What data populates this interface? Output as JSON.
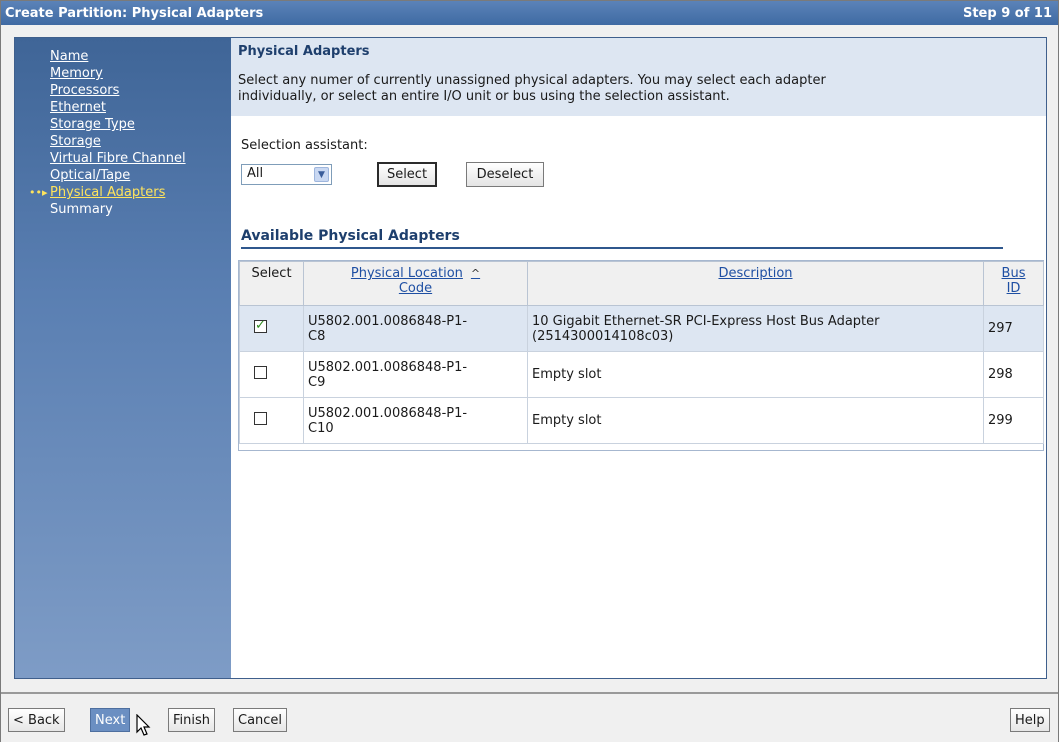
{
  "window": {
    "title": "Create Partition: Physical Adapters",
    "step": "Step 9 of 11"
  },
  "nav": {
    "items": [
      {
        "label": "Name",
        "current": false,
        "link": true
      },
      {
        "label": "Memory",
        "current": false,
        "link": true
      },
      {
        "label": "Processors",
        "current": false,
        "link": true
      },
      {
        "label": "Ethernet",
        "current": false,
        "link": true
      },
      {
        "label": "Storage Type",
        "current": false,
        "link": true
      },
      {
        "label": "Storage",
        "current": false,
        "link": true
      },
      {
        "label": "Virtual Fibre Channel",
        "current": false,
        "link": true
      },
      {
        "label": "Optical/Tape",
        "current": false,
        "link": true
      },
      {
        "label": "Physical Adapters",
        "current": true,
        "link": true
      },
      {
        "label": "Summary",
        "current": false,
        "link": false
      }
    ]
  },
  "section": {
    "title": "Physical Adapters",
    "description_line1": "Select any numer of currently unassigned physical adapters. You may select each adapter",
    "description_line2": "individually, or select an entire I/O unit or bus using the selection assistant."
  },
  "assistant": {
    "label": "Selection assistant:",
    "selected": "All",
    "select_label": "Select",
    "deselect_label": "Deselect"
  },
  "table": {
    "title": "Available Physical Adapters",
    "headers": {
      "select": "Select",
      "location_line1": "Physical Location",
      "location_line2": "Code",
      "description": "Description",
      "bus_line1": "Bus",
      "bus_line2": "ID"
    },
    "rows": [
      {
        "checked": true,
        "loc1": "U5802.001.0086848-P1-",
        "loc2": "C8",
        "desc1": "10 Gigabit Ethernet-SR PCI-Express Host Bus Adapter",
        "desc2": "(2514300014108c03)",
        "bus": "297"
      },
      {
        "checked": false,
        "loc1": "U5802.001.0086848-P1-",
        "loc2": "C9",
        "desc1": "Empty slot",
        "desc2": "",
        "bus": "298"
      },
      {
        "checked": false,
        "loc1": "U5802.001.0086848-P1-",
        "loc2": "C10",
        "desc1": "Empty slot",
        "desc2": "",
        "bus": "299"
      }
    ]
  },
  "footer": {
    "back": "< Back",
    "next": "Next",
    "finish": "Finish",
    "cancel": "Cancel",
    "help": "Help"
  },
  "icons": {
    "nav_current": "double-arrow-icon",
    "sort": "sort-ascending-icon",
    "dropdown": "chevron-down-icon",
    "cursor": "mouse-pointer-icon"
  }
}
